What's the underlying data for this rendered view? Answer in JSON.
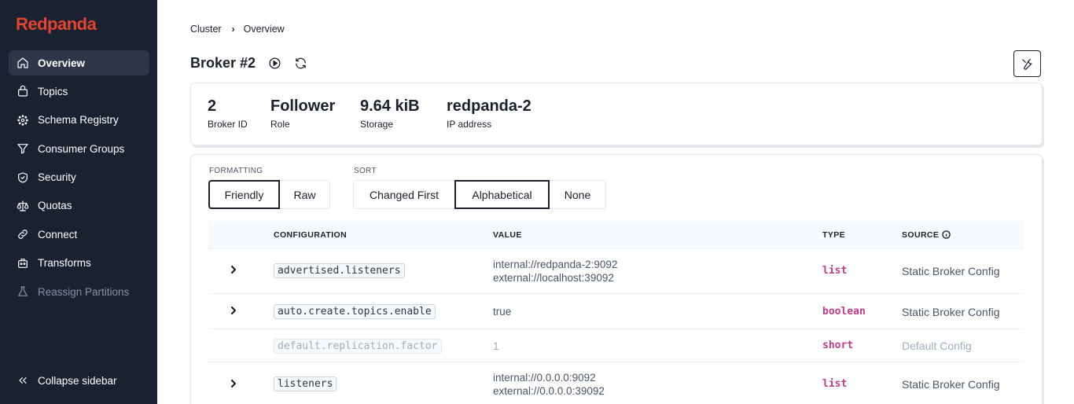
{
  "app": {
    "logo": "Redpanda"
  },
  "sidebar": {
    "items": [
      {
        "label": "Overview",
        "icon": "home-icon",
        "active": true
      },
      {
        "label": "Topics",
        "icon": "topics-icon"
      },
      {
        "label": "Schema Registry",
        "icon": "schema-registry-icon"
      },
      {
        "label": "Consumer Groups",
        "icon": "filter-icon"
      },
      {
        "label": "Security",
        "icon": "shield-icon"
      },
      {
        "label": "Quotas",
        "icon": "scale-icon"
      },
      {
        "label": "Connect",
        "icon": "link-icon"
      },
      {
        "label": "Transforms",
        "icon": "transforms-icon"
      },
      {
        "label": "Reassign Partitions",
        "icon": "flask-icon",
        "disabled": true
      }
    ],
    "collapse_label": "Collapse sidebar"
  },
  "breadcrumb": {
    "items": [
      "Cluster",
      "Overview"
    ]
  },
  "page": {
    "title": "Broker #2"
  },
  "stats": [
    {
      "value": "2",
      "label": "Broker ID"
    },
    {
      "value": "Follower",
      "label": "Role"
    },
    {
      "value": "9.64 kiB",
      "label": "Storage"
    },
    {
      "value": "redpanda-2",
      "label": "IP address"
    }
  ],
  "formatting": {
    "label": "FORMATTING",
    "options": [
      "Friendly",
      "Raw"
    ],
    "selected": "Friendly"
  },
  "sort": {
    "label": "SORT",
    "options": [
      "Changed First",
      "Alphabetical",
      "None"
    ],
    "selected": "Alphabetical"
  },
  "table": {
    "columns": [
      "CONFIGURATION",
      "VALUE",
      "TYPE",
      "SOURCE"
    ],
    "rows": [
      {
        "name": "advertised.listeners",
        "value_lines": [
          "internal://redpanda-2:9092",
          "external://localhost:39092"
        ],
        "type": "list",
        "source": "Static Broker Config",
        "expandable": true
      },
      {
        "name": "auto.create.topics.enable",
        "value_lines": [
          "true"
        ],
        "type": "boolean",
        "source": "Static Broker Config",
        "expandable": true
      },
      {
        "name": "default.replication.factor",
        "value_lines": [
          "1"
        ],
        "type": "short",
        "source": "Default Config",
        "expandable": false,
        "muted": true
      },
      {
        "name": "listeners",
        "value_lines": [
          "internal://0.0.0.0:9092",
          "external://0.0.0.0:39092"
        ],
        "type": "list",
        "source": "Static Broker Config",
        "expandable": true
      }
    ]
  },
  "colors": {
    "brand": "#e5452e",
    "sidebar_bg": "#1a2130",
    "type_accent": "#c53a8a"
  }
}
